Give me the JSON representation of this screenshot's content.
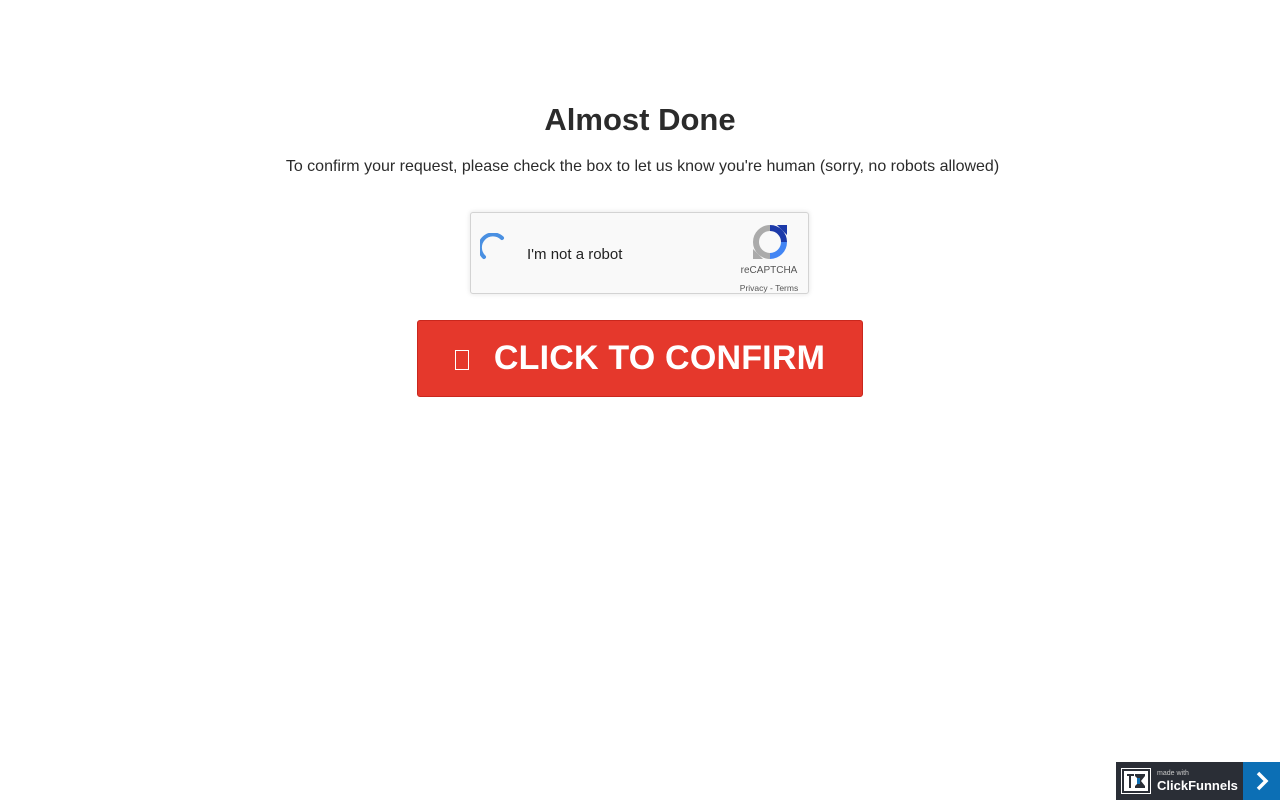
{
  "header": {
    "title": "Almost Done",
    "subtitle": "To confirm your request, please check the box to let us know you're human (sorry, no robots allowed)"
  },
  "captcha": {
    "label": "I'm not a robot",
    "brand": "reCAPTCHA",
    "privacy_link": "Privacy",
    "separator": " - ",
    "terms_link": "Terms",
    "spinner_icon": "loading-spinner-icon",
    "logo_icon": "recaptcha-logo-icon",
    "spinner_color": "#4a90e2"
  },
  "confirm_button": {
    "label": "CLICK TO CONFIRM",
    "icon": "square-outline-icon",
    "color": "#e5382c"
  },
  "badge": {
    "made_with": "made with",
    "name": "ClickFunnels",
    "arrow_icon": "chevron-right-icon",
    "bg_color": "#2a2e36",
    "arrow_bg_color": "#0c6fb5"
  }
}
